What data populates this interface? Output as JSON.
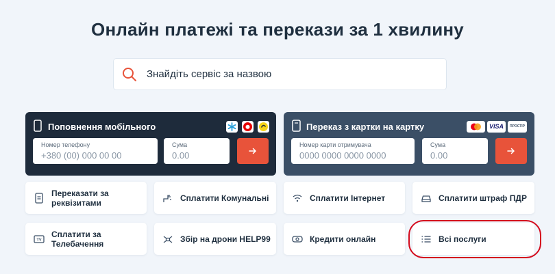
{
  "page": {
    "title": "Онлайн платежі та перекази за 1 хвилину"
  },
  "search": {
    "placeholder": "Знайдіть сервіс за назвою",
    "icon": "search-icon"
  },
  "mobile_card": {
    "title": "Поповнення мобільного",
    "phone_label": "Номер телефону",
    "phone_placeholder": "+380 (00) 000 00 00",
    "amount_label": "Сума",
    "amount_placeholder": "0.00",
    "operators": [
      "kyivstar-logo",
      "vodafone-logo",
      "lifecell-logo"
    ]
  },
  "transfer_card": {
    "title": "Переказ з картки на картку",
    "card_label": "Номер карти отримувача",
    "card_placeholder": "0000 0000 0000 0000",
    "amount_label": "Сума",
    "amount_placeholder": "0.00",
    "payment_systems": [
      "mastercard-logo",
      "visa-logo",
      "prostir-logo"
    ],
    "prostir_text": "ПРОСТІР",
    "visa_text": "VISA"
  },
  "services": [
    {
      "label": "Переказати за реквізитами",
      "icon": "document-icon"
    },
    {
      "label": "Сплатити Комунальні",
      "icon": "faucet-icon"
    },
    {
      "label": "Сплатити Інтернет",
      "icon": "wifi-icon"
    },
    {
      "label": "Сплатити штраф ПДР",
      "icon": "car-icon"
    },
    {
      "label": "Сплатити за Телебачення",
      "icon": "tv-icon"
    },
    {
      "label": "Збір на дрони HELP99",
      "icon": "drone-icon"
    },
    {
      "label": "Кредити онлайн",
      "icon": "money-icon"
    },
    {
      "label": "Всі послуги",
      "icon": "list-icon"
    }
  ],
  "colors": {
    "accent": "#e8533a",
    "mobile_card_bg": "#1e2b3b",
    "transfer_card_bg": "#3b4f66",
    "page_bg": "#f1f5fa",
    "highlight": "#d40a1c"
  }
}
